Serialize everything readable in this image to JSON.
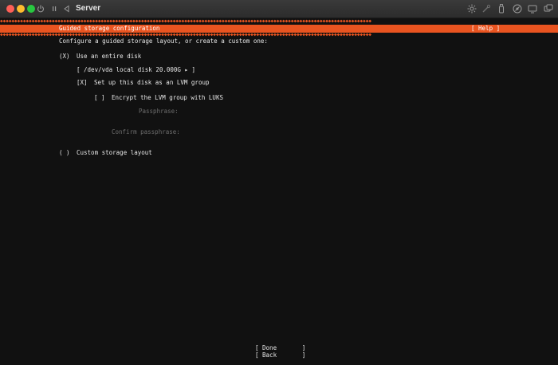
{
  "window": {
    "title": "Server"
  },
  "installer": {
    "header_title": "Guided storage configuration",
    "help_label": "[ Help ]",
    "intro": "Configure a guided storage layout, or create a custom one:",
    "use_entire_disk": {
      "marker": "(X)",
      "label": "Use an entire disk"
    },
    "disk_select": {
      "value": "[ /dev/vda local disk 20.000G ▸ ]"
    },
    "lvm": {
      "marker": "[X]",
      "label": "Set up this disk as an LVM group"
    },
    "luks": {
      "marker": "[ ]",
      "label": "Encrypt the LVM group with LUKS"
    },
    "passphrase_label": "Passphrase:",
    "confirm_passphrase_label": "Confirm passphrase:",
    "custom_layout": {
      "marker": "( )",
      "label": "Custom storage layout"
    },
    "done_button": "[ Done       ]",
    "back_button": "[ Back       ]"
  },
  "colors": {
    "accent": "#e95420",
    "background": "#111111",
    "text": "#e8e8e8",
    "disabled_text": "#6e6e6e"
  },
  "icons": {
    "toolbar_left": [
      "power-icon",
      "pause-icon",
      "back-icon"
    ],
    "toolbar_right": [
      "brightness-icon",
      "wrench-icon",
      "usb-icon",
      "network-icon",
      "display-icon",
      "windows-icon"
    ]
  }
}
